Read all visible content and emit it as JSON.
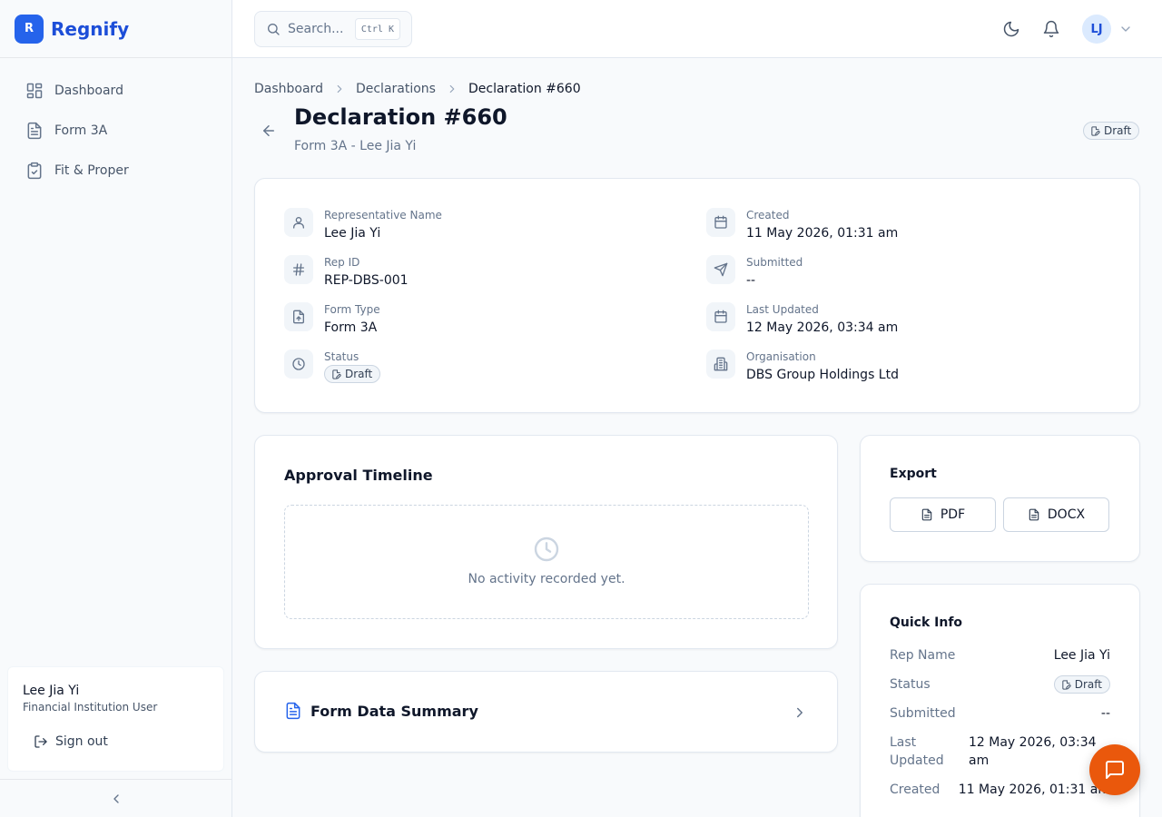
{
  "brand": {
    "logo_letter": "R",
    "name": "Regnify"
  },
  "sidebar": {
    "items": [
      {
        "label": "Dashboard",
        "icon": "layout-grid-icon"
      },
      {
        "label": "Form 3A",
        "icon": "file-text-icon"
      },
      {
        "label": "Fit & Proper",
        "icon": "clipboard-check-icon"
      }
    ],
    "user": {
      "name": "Lee Jia Yi",
      "role": "Financial Institution User"
    },
    "signout_label": "Sign out"
  },
  "topbar": {
    "search_placeholder": "Search...",
    "search_shortcut": "Ctrl K",
    "avatar_initials": "LJ"
  },
  "breadcrumb": [
    "Dashboard",
    "Declarations",
    "Declaration #660"
  ],
  "header": {
    "title": "Declaration #660",
    "subtitle": "Form 3A - Lee Jia Yi",
    "status_badge": "Draft"
  },
  "details": {
    "representative_name": {
      "label": "Representative Name",
      "value": "Lee Jia Yi"
    },
    "rep_id": {
      "label": "Rep ID",
      "value": "REP-DBS-001"
    },
    "form_type": {
      "label": "Form Type",
      "value": "Form 3A"
    },
    "status": {
      "label": "Status",
      "value": "Draft"
    },
    "created": {
      "label": "Created",
      "value": "11 May 2026, 01:31 am"
    },
    "submitted": {
      "label": "Submitted",
      "value": "--"
    },
    "last_updated": {
      "label": "Last Updated",
      "value": "12 May 2026, 03:34 am"
    },
    "organisation": {
      "label": "Organisation",
      "value": "DBS Group Holdings Ltd"
    }
  },
  "timeline": {
    "title": "Approval Timeline",
    "empty_text": "No activity recorded yet."
  },
  "summary": {
    "title": "Form Data Summary"
  },
  "export": {
    "title": "Export",
    "pdf_label": "PDF",
    "docx_label": "DOCX"
  },
  "quick_info": {
    "title": "Quick Info",
    "rep_name": {
      "label": "Rep Name",
      "value": "Lee Jia Yi"
    },
    "status": {
      "label": "Status",
      "value": "Draft"
    },
    "submitted": {
      "label": "Submitted",
      "value": "--"
    },
    "last_updated": {
      "label_line1": "Last",
      "label_line2": "Updated",
      "value_line1": "12 May 2026, 03:34",
      "value_line2": "am"
    },
    "created": {
      "label": "Created",
      "value": "11 May 2026, 01:31 am"
    }
  },
  "colors": {
    "brand": "#2563eb",
    "fab": "#ea580c"
  }
}
